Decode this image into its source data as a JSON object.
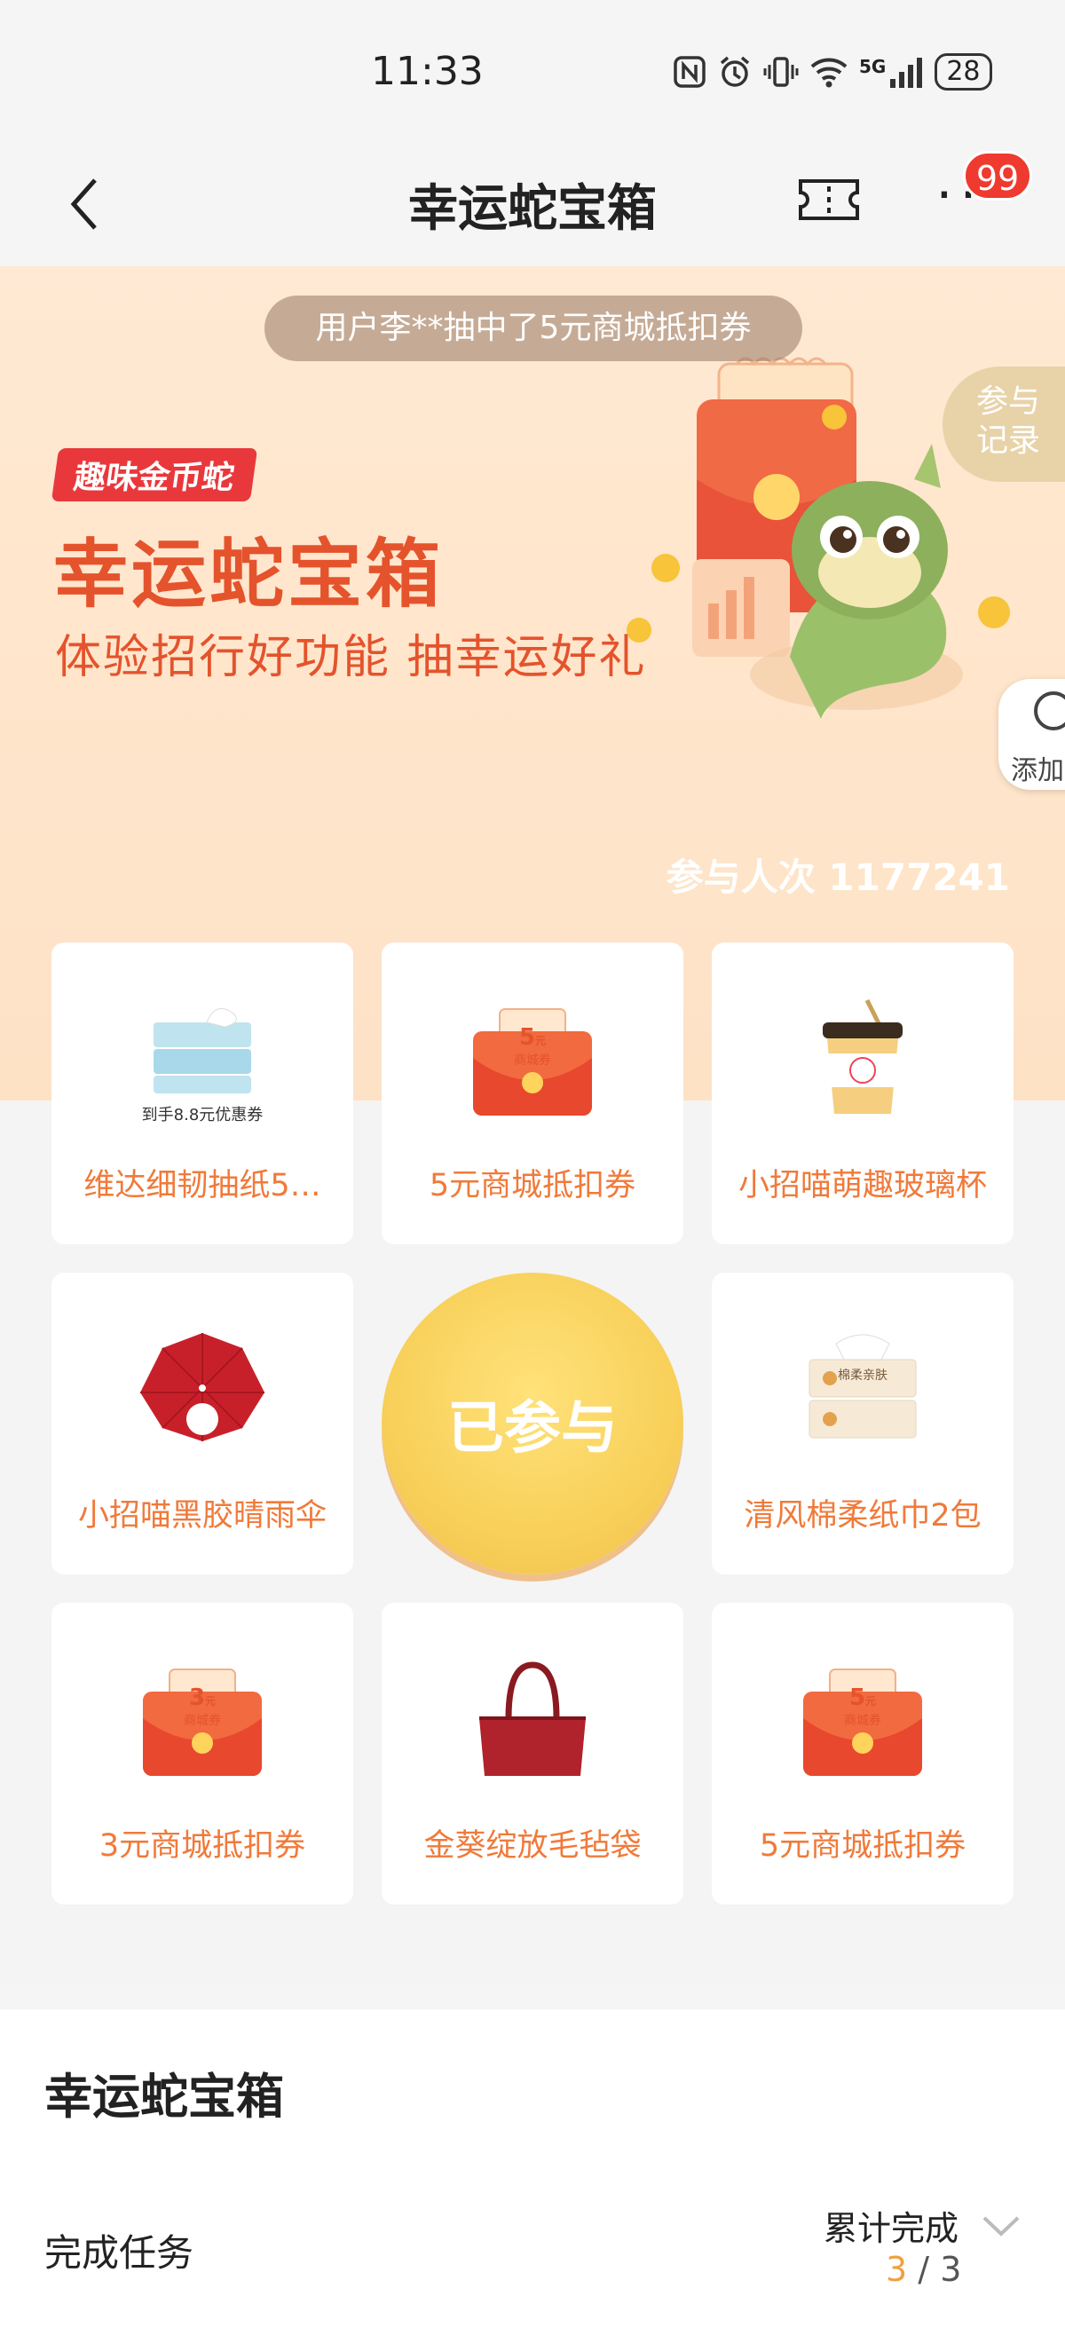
{
  "status_bar": {
    "time": "11:33",
    "icons": [
      "nfc-icon",
      "alarm-icon",
      "vibrate-icon",
      "wifi-icon",
      "signal-5g-icon"
    ],
    "network_label": "5G",
    "battery": "28"
  },
  "nav": {
    "title": "幸运蛇宝箱",
    "badge_count": "99"
  },
  "banner": {
    "ticker": "用户李**抽中了5元商城抵扣券",
    "records_label_line1": "参与",
    "records_label_line2": "记录",
    "add_label": "添加",
    "tag": "趣味金币蛇",
    "title": "幸运蛇宝箱",
    "subtitle": "体验招行好功能 抽幸运好礼",
    "participants": "参与人次 1177241"
  },
  "prizes": [
    {
      "name": "维达细韧抽纸5…",
      "image": "tissue-pack-icon",
      "caption": "到手8.8元优惠券"
    },
    {
      "name": "5元商城抵扣券",
      "image": "coupon-envelope-icon",
      "amount": "5",
      "unit": "元",
      "label": "商城券"
    },
    {
      "name": "小招喵萌趣玻璃杯",
      "image": "glass-cup-icon"
    },
    {
      "name": "小招喵黑胶晴雨伞",
      "image": "umbrella-icon"
    },
    {
      "name": "清风棉柔纸巾2包",
      "image": "tissue-box-icon",
      "box_label": "棉柔亲肤"
    },
    {
      "name": "3元商城抵扣券",
      "image": "coupon-envelope-icon",
      "amount": "3",
      "unit": "元",
      "label": "商城券"
    },
    {
      "name": "金葵绽放毛毡袋",
      "image": "felt-bag-icon"
    },
    {
      "name": "5元商城抵扣券",
      "image": "coupon-envelope-icon",
      "amount": "5",
      "unit": "元",
      "label": "商城券"
    }
  ],
  "center_button": "已参与",
  "tasks": {
    "title": "幸运蛇宝箱",
    "row_label": "完成任务",
    "progress_label": "累计完成",
    "completed": "3",
    "separator": "/",
    "total": "3"
  },
  "colors": {
    "accent_orange": "#f07a3a",
    "title_red": "#e4532c",
    "badge_red": "#ef3a2f",
    "gold": "#f8d05a"
  }
}
